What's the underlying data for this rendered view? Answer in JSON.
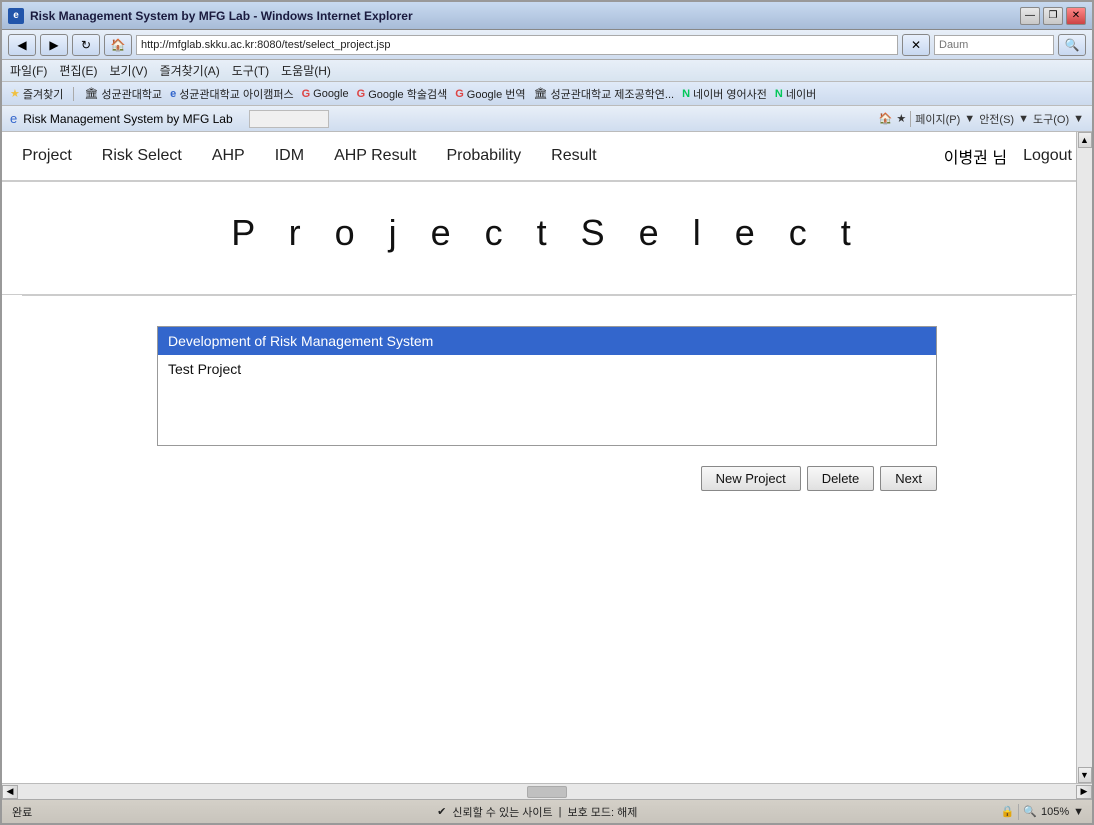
{
  "window": {
    "title": "Risk Management System by MFG Lab - Windows Internet Explorer",
    "icon": "e"
  },
  "titlebar": {
    "minimize": "—",
    "restore": "❐",
    "close": "✕"
  },
  "addressbar": {
    "back": "◀",
    "forward": "▶",
    "url": "http://mfglab.skku.ac.kr:8080/test/select_project.jsp",
    "search_placeholder": "Daum",
    "refresh": "↻",
    "stop": "✕"
  },
  "menubar": {
    "items": [
      {
        "label": "파일(F)"
      },
      {
        "label": "편집(E)"
      },
      {
        "label": "보기(V)"
      },
      {
        "label": "즐겨찾기(A)"
      },
      {
        "label": "도구(T)"
      },
      {
        "label": "도움말(H)"
      }
    ]
  },
  "favoritesbar": {
    "items": [
      {
        "label": "즐겨찾기",
        "icon": "★"
      },
      {
        "label": "성균관대학교",
        "icon": "🏛"
      },
      {
        "label": "성균관대학교 아이캠퍼스",
        "icon": "e"
      },
      {
        "label": "Google",
        "icon": "G"
      },
      {
        "label": "Google 학술검색",
        "icon": "G"
      },
      {
        "label": "Google 번역",
        "icon": "G"
      },
      {
        "label": "성균관대학교 제조공학연...",
        "icon": "🏛"
      },
      {
        "label": "네이버 영어사전",
        "icon": "N"
      },
      {
        "label": "네이버",
        "icon": "N"
      }
    ]
  },
  "ie_toolbar": {
    "tab_label": "Risk Management System by MFG Lab",
    "home_icon": "🏠",
    "favorites_icon": "★",
    "tools_icon": "⚙",
    "page_label": "페이지(P)",
    "safety_label": "안전(S)",
    "tools_label": "도구(O)",
    "right_arrow": "▼"
  },
  "nav": {
    "links": [
      {
        "label": "Project"
      },
      {
        "label": "Risk Select"
      },
      {
        "label": "AHP"
      },
      {
        "label": "IDM"
      },
      {
        "label": "AHP Result"
      },
      {
        "label": "Probability"
      },
      {
        "label": "Result"
      }
    ],
    "user_name": "이병권 님",
    "logout_label": "Logout"
  },
  "page": {
    "title": "P r o j e c t   S e l e c t"
  },
  "projects": [
    {
      "label": "Development of Risk Management System",
      "selected": true
    },
    {
      "label": "Test Project",
      "selected": false
    }
  ],
  "buttons": {
    "new_project": "New Project",
    "delete": "Delete",
    "next": "Next"
  },
  "statusbar": {
    "status": "완료",
    "security": "신뢰할 수 있는 사이트",
    "protection": "보호 모드: 해제",
    "zoom": "105%"
  }
}
